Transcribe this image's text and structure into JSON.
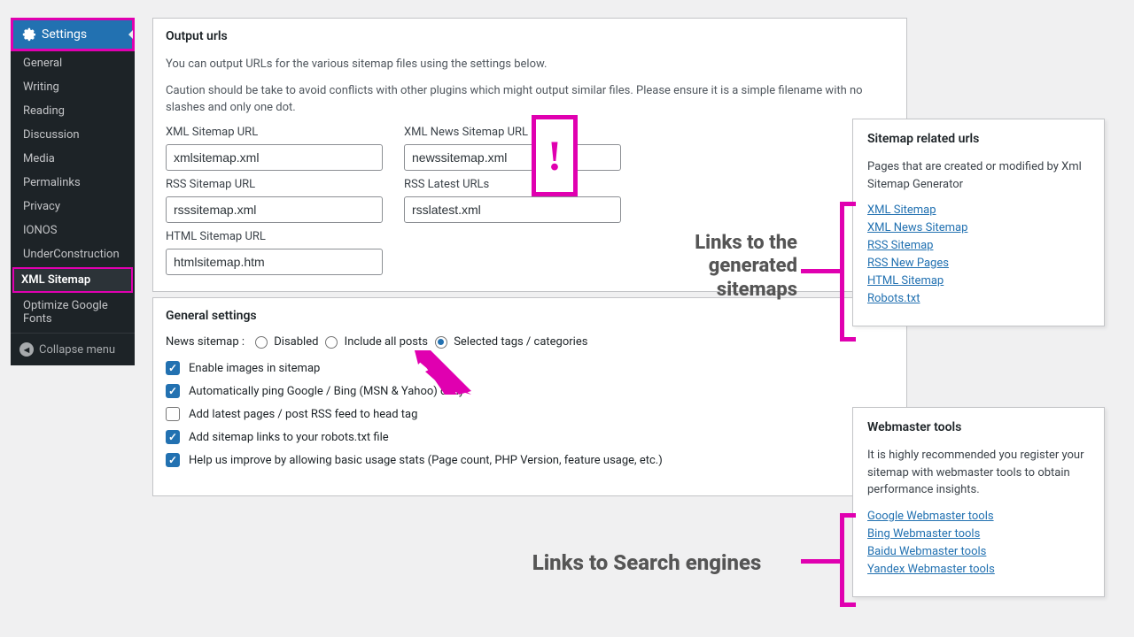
{
  "sidebar": {
    "head": "Settings",
    "items": [
      "General",
      "Writing",
      "Reading",
      "Discussion",
      "Media",
      "Permalinks",
      "Privacy",
      "IONOS",
      "UnderConstruction",
      "XML Sitemap",
      "Optimize Google Fonts"
    ],
    "active": "XML Sitemap",
    "collapse": "Collapse menu"
  },
  "outputs": {
    "title": "Output urls",
    "desc1": "You can output URLs for the various sitemap files using the settings below.",
    "desc2": "Caution should be take to avoid conflicts with other plugins which might output similar files. Please ensure it is a simple filename with no slashes and only one dot.",
    "fields": {
      "xml": {
        "label": "XML Sitemap URL",
        "value": "xmlsitemap.xml"
      },
      "xmlnews": {
        "label": "XML News Sitemap URL",
        "value": "newssitemap.xml"
      },
      "rss": {
        "label": "RSS Sitemap URL",
        "value": "rsssitemap.xml"
      },
      "rsslatest": {
        "label": "RSS Latest URLs",
        "value": "rsslatest.xml"
      },
      "html": {
        "label": "HTML Sitemap URL",
        "value": "htmlsitemap.htm"
      }
    }
  },
  "general": {
    "title": "General settings",
    "news_label": "News sitemap :",
    "news_options": [
      "Disabled",
      "Include all posts",
      "Selected tags / categories"
    ],
    "news_selected": "Selected tags / categories",
    "checks": [
      {
        "label": "Enable images in sitemap",
        "checked": true
      },
      {
        "label": "Automatically ping Google / Bing (MSN & Yahoo) daily",
        "checked": true
      },
      {
        "label": "Add latest pages / post RSS feed to head tag",
        "checked": false
      },
      {
        "label": "Add sitemap links to your robots.txt file",
        "checked": true
      },
      {
        "label": "Help us improve by allowing basic usage stats (Page count, PHP Version, feature usage, etc.)",
        "checked": true
      }
    ]
  },
  "related": {
    "title": "Sitemap related urls",
    "desc": "Pages that are created or modified by Xml Sitemap Generator",
    "links": [
      "XML Sitemap",
      "XML News Sitemap",
      "RSS Sitemap",
      "RSS New Pages",
      "HTML Sitemap",
      "Robots.txt"
    ]
  },
  "tools": {
    "title": "Webmaster tools",
    "desc": "It is highly recommended you register your sitemap with webmaster tools to obtain performance insights.",
    "links": [
      "Google Webmaster tools",
      "Bing Webmaster tools",
      "Baidu Webmaster tools",
      "Yandex Webmaster tools"
    ]
  },
  "annotations": {
    "links_sitemaps": "Links to the generated sitemaps",
    "links_engines": "Links to Search engines"
  }
}
